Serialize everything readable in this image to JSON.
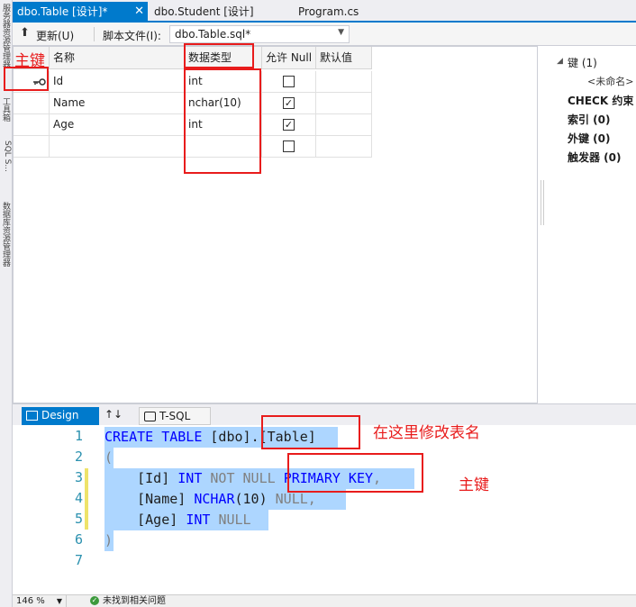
{
  "left_strip": {
    "labels": [
      "服务器资源管理器",
      "工具箱",
      "SQL S...",
      "数据库资源管理器"
    ]
  },
  "tabs": [
    {
      "label": "dbo.Table [设计]*",
      "active": true,
      "close": "✕"
    },
    {
      "label": "dbo.Student [设计]",
      "active": false
    },
    {
      "label": "Program.cs",
      "active": false
    }
  ],
  "toolbar": {
    "update_label": "更新(U)",
    "script_file_label": "脚本文件(I):",
    "script_file_value": "dbo.Table.sql*"
  },
  "grid": {
    "columns": [
      "名称",
      "数据类型",
      "允许 Null",
      "默认值"
    ],
    "rows": [
      {
        "name": "Id",
        "type": "int",
        "allow_null": false,
        "primary_key": true
      },
      {
        "name": "Name",
        "type": "nchar(10)",
        "allow_null": true,
        "primary_key": false
      },
      {
        "name": "Age",
        "type": "int",
        "allow_null": true,
        "primary_key": false
      },
      {
        "name": "",
        "type": "",
        "allow_null": false,
        "primary_key": false
      }
    ],
    "check_mark": "✓"
  },
  "properties": {
    "keys": "键 (1)",
    "unnamed": "<未命名>",
    "check": "CHECK 约束",
    "indexes": "索引 (0)",
    "foreign_keys": "外键 (0)",
    "triggers": "触发器 (0)"
  },
  "pane_tabs": {
    "design": "Design",
    "swap": "↑↓",
    "tsql": "T-SQL"
  },
  "code": {
    "line_numbers": [
      "1",
      "2",
      "3",
      "4",
      "5",
      "6",
      "7"
    ],
    "l1_kw1": "CREATE TABLE",
    "l1_schema": "[dbo]",
    "l1_dot": ".",
    "l1_table": "[Table]",
    "l2": "(",
    "l3_col": "[Id]",
    "l3_type": "INT",
    "l3_notnull": "NOT NULL",
    "l3_pk": "PRIMARY KEY",
    "l3_comma": ",",
    "l4_col": "[Name]",
    "l4_type": "NCHAR",
    "l4_len": "(10)",
    "l4_null": "NULL,",
    "l5_col": "[Age]",
    "l5_type": "INT",
    "l5_null": "NULL",
    "l6": ")"
  },
  "status": {
    "zoom": "146 %",
    "message": "未找到相关问题",
    "ok_symbol": "✓"
  },
  "annotations": {
    "primary_key_top": "主键",
    "rename_table": "在这里修改表名",
    "primary_key_code": "主键"
  },
  "colors": {
    "accent": "#007acc",
    "annotation": "#e81c1c",
    "selection": "#add6ff",
    "keyword": "#0000ff",
    "line_number": "#2b91af"
  }
}
